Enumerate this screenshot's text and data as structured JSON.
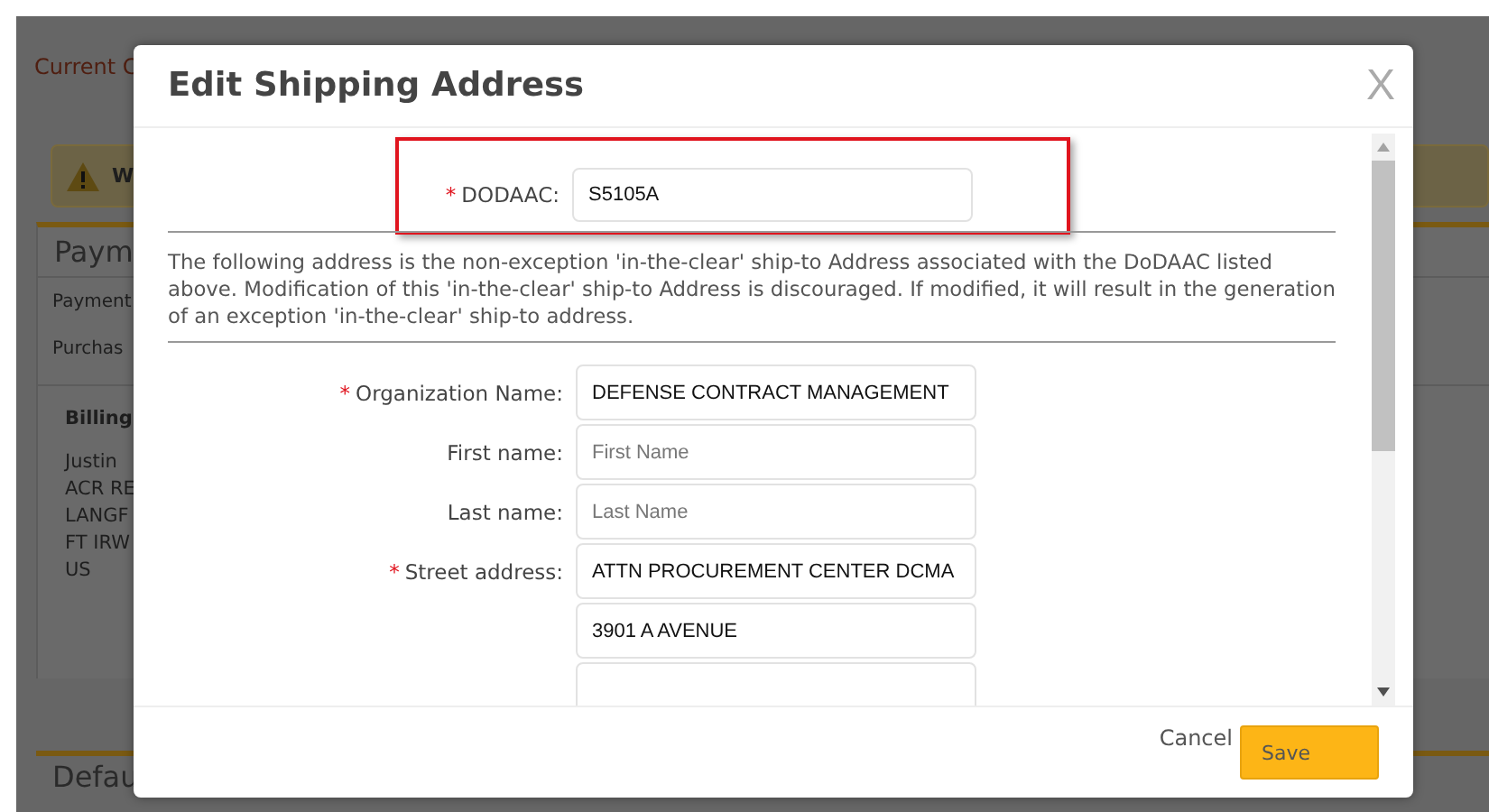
{
  "background": {
    "header": "Current C",
    "warning": {
      "text": "W"
    },
    "panel": {
      "title": "Paym",
      "rows": [
        "Payment",
        "Purchas"
      ],
      "billing": {
        "title": "Billing",
        "lines": [
          "Justin",
          "ACR RE",
          "LANGF",
          "FT IRW",
          "US"
        ]
      }
    },
    "next_section": "Defau"
  },
  "dialog": {
    "title": "Edit Shipping Address",
    "close": "X",
    "required_mark": "*",
    "dodaac": {
      "label": "DODAAC:",
      "required": true,
      "value": "S5105A",
      "highlighted": true
    },
    "notice": "The following address is the non-exception 'in-the-clear' ship-to Address associated with the DoDAAC listed above. Modification of this 'in-the-clear' ship-to Address is discouraged. If modified, it will result in the generation of an exception 'in-the-clear' ship-to address.",
    "fields": [
      {
        "kind": "labeled",
        "label": "Organization Name:",
        "required": true,
        "value": "DEFENSE CONTRACT MANAGEMENT"
      },
      {
        "kind": "labeled",
        "label": "First name:",
        "required": false,
        "placeholder": "First Name"
      },
      {
        "kind": "labeled",
        "label": "Last name:",
        "required": false,
        "placeholder": "Last Name"
      },
      {
        "kind": "labeled",
        "label": "Street address:",
        "required": true,
        "value": "ATTN PROCUREMENT CENTER DCMA"
      },
      {
        "kind": "address_line",
        "value": "3901 A AVENUE"
      },
      {
        "kind": "address_line"
      }
    ],
    "buttons": {
      "cancel": "Cancel",
      "save": "Save"
    }
  }
}
